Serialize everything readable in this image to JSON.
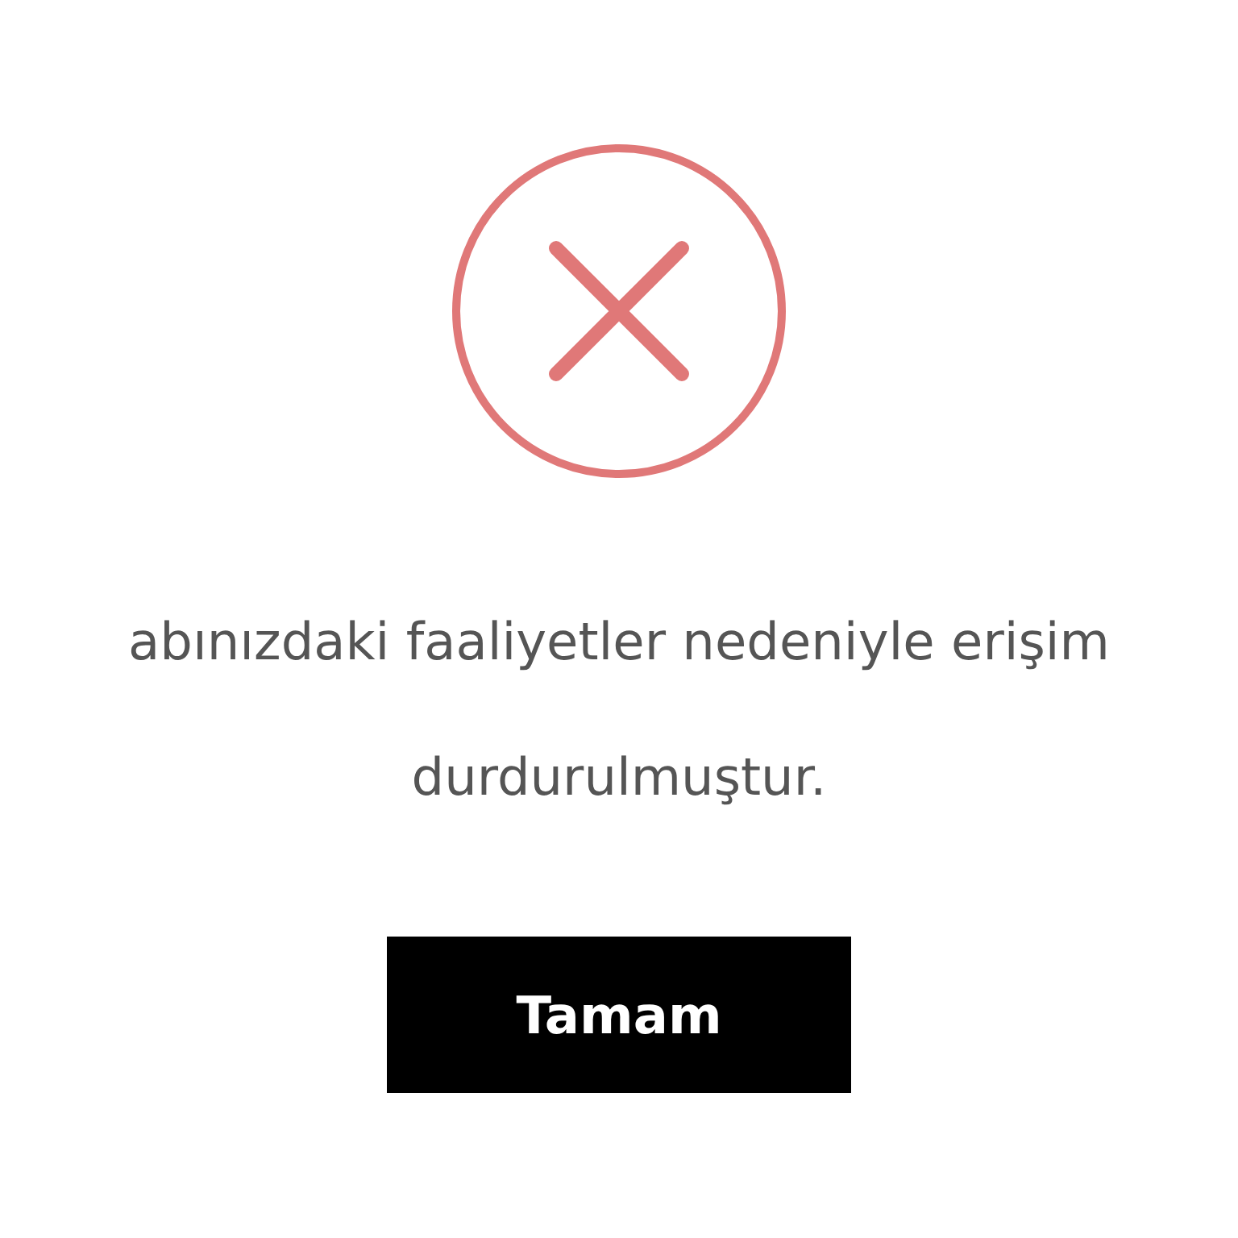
{
  "dialog": {
    "message": "abınızdaki faaliyetler nedeniyle erişim durdurulmuştur.",
    "button": "Tamam"
  }
}
